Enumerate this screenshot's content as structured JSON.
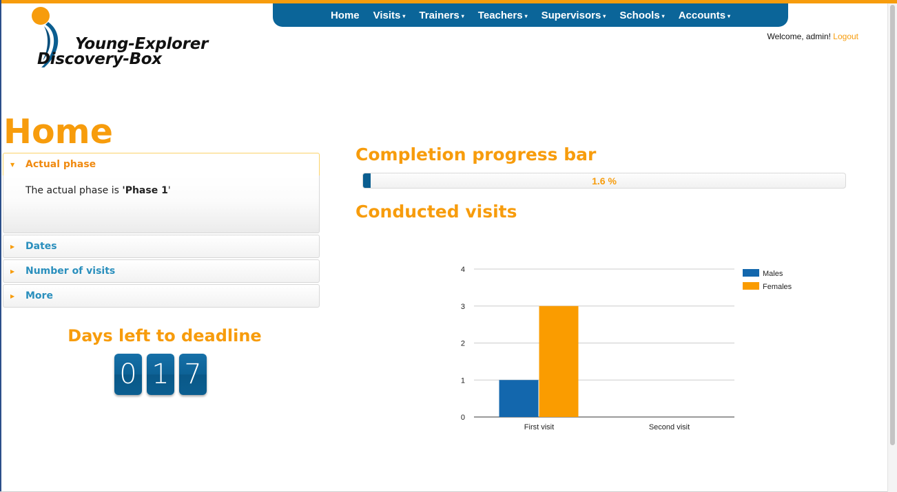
{
  "header": {
    "logo": {
      "line1": "Young-Explorer",
      "line2": "Discovery-Box"
    },
    "nav": [
      {
        "label": "Home",
        "dropdown": false
      },
      {
        "label": "Visits",
        "dropdown": true
      },
      {
        "label": "Trainers",
        "dropdown": true
      },
      {
        "label": "Teachers",
        "dropdown": true
      },
      {
        "label": "Supervisors",
        "dropdown": true
      },
      {
        "label": "Schools",
        "dropdown": true
      },
      {
        "label": "Accounts",
        "dropdown": true
      }
    ],
    "welcome_text": "Welcome, admin!",
    "logout_label": "Logout"
  },
  "page_title": "Home",
  "accordion": {
    "sections": [
      {
        "label": "Actual phase",
        "expanded": true
      },
      {
        "label": "Dates",
        "expanded": false
      },
      {
        "label": "Number of visits",
        "expanded": false
      },
      {
        "label": "More",
        "expanded": false
      }
    ],
    "body_prefix": "The actual phase is ",
    "body_quote_open": "'",
    "body_value": "Phase 1",
    "body_quote_close": "'"
  },
  "deadline": {
    "title": "Days left to deadline",
    "digits": [
      "0",
      "1",
      "7"
    ]
  },
  "progress": {
    "title": "Completion progress bar",
    "value_percent": 1.6,
    "label": "1.6 %"
  },
  "visits": {
    "title": "Conducted visits"
  },
  "colors": {
    "accent_orange": "#f79c0c",
    "nav_blue": "#0b6599",
    "males": "#1367ad",
    "females": "#fa9c00"
  },
  "chart_data": {
    "type": "bar",
    "categories": [
      "First visit",
      "Second visit"
    ],
    "series": [
      {
        "name": "Males",
        "values": [
          1,
          0
        ]
      },
      {
        "name": "Females",
        "values": [
          3,
          0
        ]
      }
    ],
    "yticks": [
      "0",
      "1",
      "2",
      "3",
      "4"
    ],
    "ylim": [
      0,
      4
    ],
    "grid": true,
    "legend": "right"
  }
}
